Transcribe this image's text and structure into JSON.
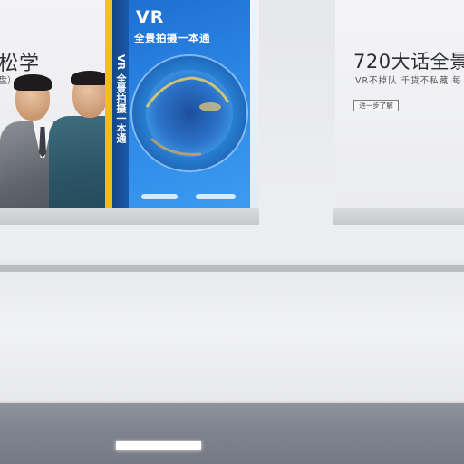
{
  "left_panel": {
    "heading": "松学",
    "subheading": "盘）"
  },
  "book": {
    "title": "VR",
    "subtitle": "全景拍摄一本通",
    "spine_text": "VR 全景拍摄一本通"
  },
  "right_panel": {
    "title": "720大话全景",
    "tagline": "VR不掉队 千货不私藏 每",
    "more_button": "进一步了解"
  },
  "colors": {
    "book_blue": "#1e6fd0",
    "spine_yellow": "#f2c02a",
    "floor_gray": "#7f848e"
  }
}
